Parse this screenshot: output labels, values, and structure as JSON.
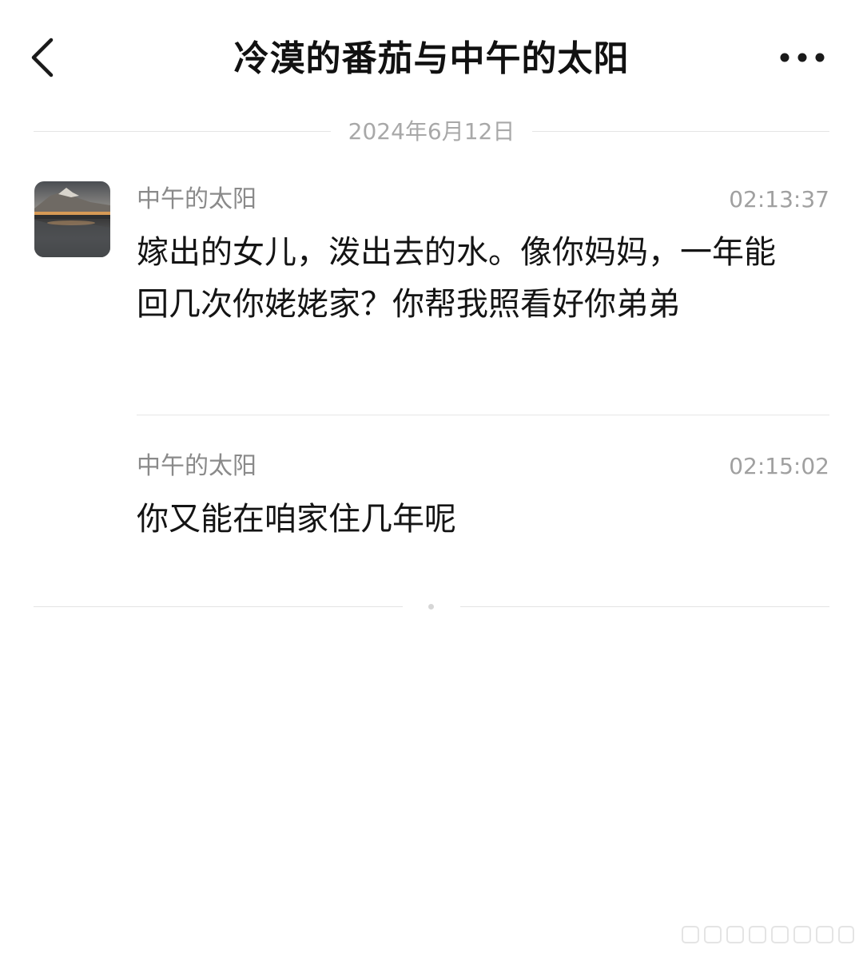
{
  "header": {
    "title": "冷漠的番茄与中午的太阳",
    "back_icon": "chevron-left-icon",
    "more_icon": "more-dots-icon"
  },
  "conversation": {
    "date": "2024年6月12日",
    "messages": [
      {
        "sender": "中午的太阳",
        "time": "02:13:37",
        "text": "嫁出的女儿，泼出去的水。像你妈妈，一年能回几次你姥姥家？你帮我照看好你弟弟"
      },
      {
        "sender": "中午的太阳",
        "time": "02:15:02",
        "text": "你又能在咱家住几年呢"
      }
    ]
  },
  "colors": {
    "title": "#111111",
    "message_text": "#141414",
    "meta_text": "#8a8a8a",
    "divider": "#e4e4e4",
    "background": "#ffffff"
  }
}
